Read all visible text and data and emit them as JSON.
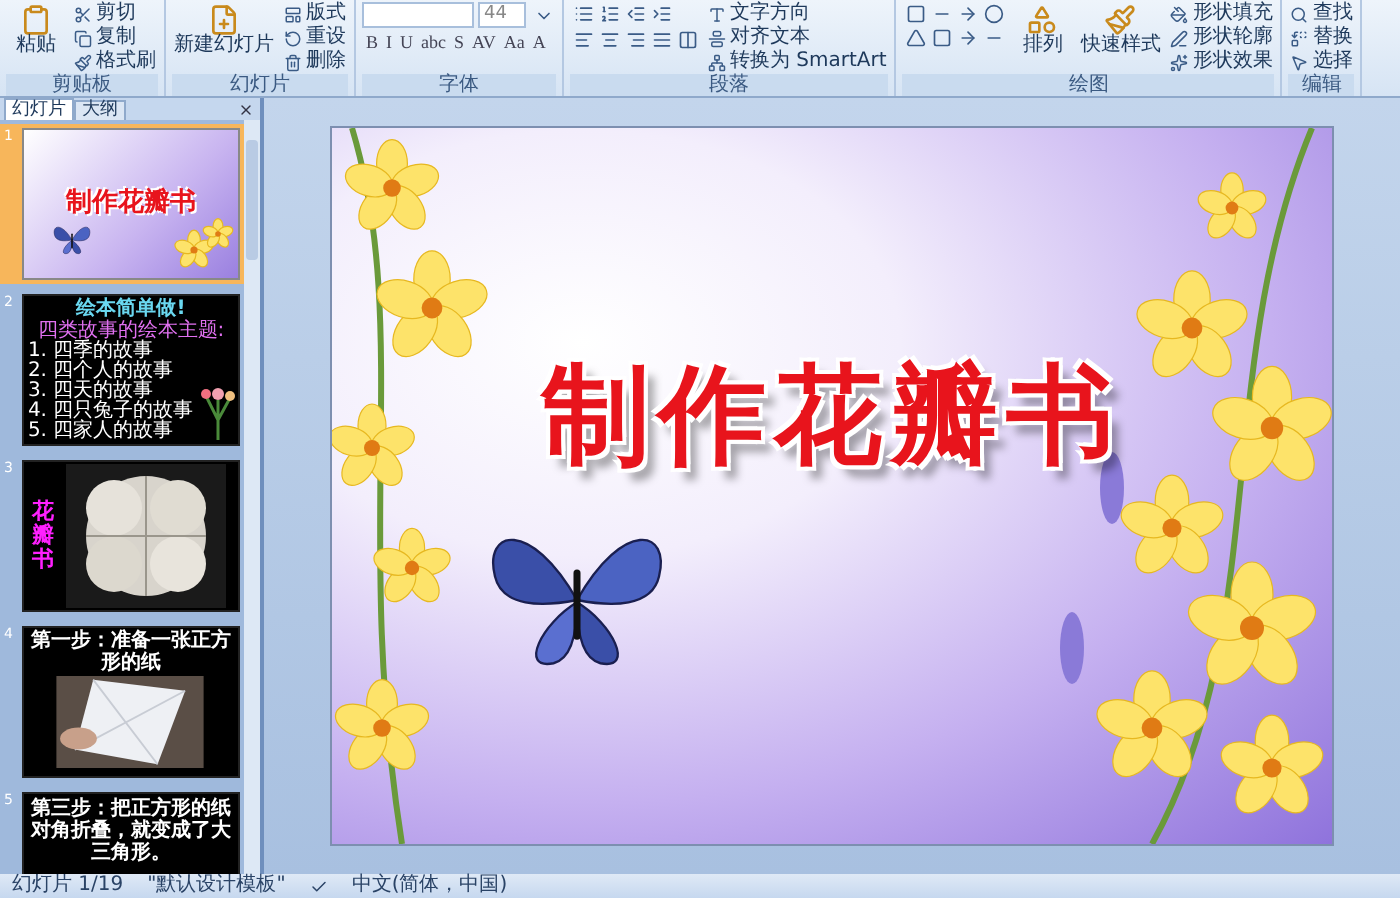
{
  "ribbon": {
    "groups": [
      {
        "kind": "clipboard",
        "label": "剪贴板",
        "large": [
          "粘贴"
        ],
        "small": [
          "剪切",
          "复制",
          "格式刷"
        ]
      },
      {
        "kind": "slides",
        "label": "幻灯片",
        "large": [
          "新建幻灯片"
        ],
        "small": [
          "版式",
          "重设",
          "删除"
        ]
      },
      {
        "kind": "font",
        "label": "字体",
        "size": "44",
        "glyphs": [
          "B",
          "I",
          "U",
          "abc",
          "S",
          "AV",
          "Aa",
          "A"
        ]
      },
      {
        "kind": "paragraph",
        "label": "段落",
        "small": [
          "文字方向",
          "对齐文本",
          "转换为 SmartArt"
        ]
      },
      {
        "kind": "drawing",
        "label": "绘图",
        "large": [
          "排列",
          "快速样式"
        ],
        "small": [
          "形状填充",
          "形状轮廓",
          "形状效果"
        ]
      },
      {
        "kind": "editing",
        "label": "编辑",
        "small": [
          "查找",
          "替换",
          "选择"
        ]
      }
    ]
  },
  "sidebar": {
    "tabs": [
      {
        "label": "幻灯片",
        "selected": true
      },
      {
        "label": "大纲",
        "selected": false
      }
    ],
    "thumbnails": [
      {
        "kind": "title",
        "number": "1",
        "selected": true,
        "title": "制作花瓣书"
      },
      {
        "kind": "list",
        "number": "2",
        "selected": false,
        "title": "绘本简单做!",
        "subtitle": "四类故事的绘本主题:",
        "lines": [
          "1. 四季的故事",
          "2. 四个人的故事",
          "3. 四天的故事",
          "4. 四只兔子的故事",
          "5. 四家人的故事"
        ]
      },
      {
        "kind": "vertical",
        "number": "3",
        "selected": false,
        "title": "花瓣书"
      },
      {
        "number": "4",
        "selected": false,
        "title": "第一步：准备一张正方形的纸"
      },
      {
        "kind": "caption",
        "number": "5",
        "selected": false,
        "title": "第三步：把正方形的纸对角折叠，就变成了大三角形。"
      }
    ]
  },
  "slide": {
    "title": "制作花瓣书"
  },
  "status_bar": [
    "幻灯片 1/19",
    "\"默认设计模板\"",
    "中文(简体，中国)"
  ]
}
